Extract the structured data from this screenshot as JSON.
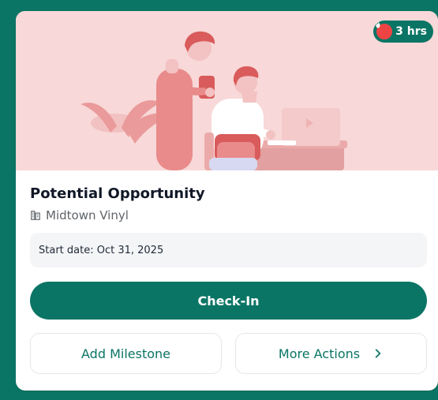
{
  "card": {
    "badge": {
      "icon": "fire-icon",
      "text": "3 hrs"
    },
    "title": "Potential Opportunity",
    "company": {
      "icon": "building-icon",
      "name": "Midtown Vinyl"
    },
    "start_date": "Start date: Oct 31, 2025",
    "checkin_label": "Check-In",
    "actions": {
      "add_milestone": "Add Milestone",
      "more_actions": "More Actions",
      "more_actions_icon": "chevron-right-icon"
    }
  },
  "colors": {
    "brand_teal": "#0b7565",
    "hero_pink": "#f8d8d8",
    "fire_red": "#ef4444"
  }
}
